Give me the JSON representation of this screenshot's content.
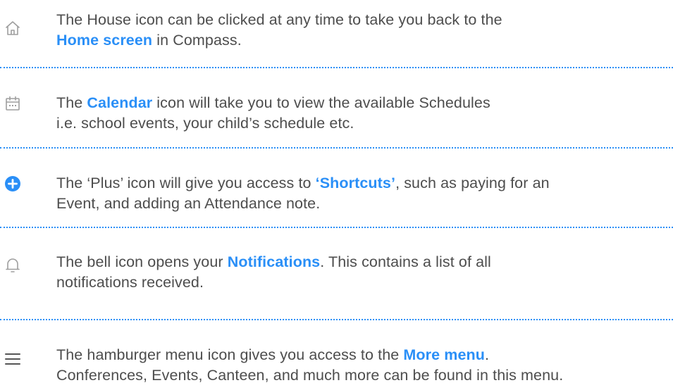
{
  "items": [
    {
      "icon": "house-icon",
      "line1": {
        "pre": "The House icon can be clicked at any time to take you back to the",
        "hl": "",
        "post": ""
      },
      "line2": {
        "pre": "",
        "hl": "Home screen",
        "post": " in Compass."
      }
    },
    {
      "icon": "calendar-icon",
      "line1": {
        "pre": "The ",
        "hl": "Calendar",
        "post": " icon will take you to view the available Schedules"
      },
      "line2": {
        "pre": "i.e. school events, your child’s schedule etc.",
        "hl": "",
        "post": ""
      }
    },
    {
      "icon": "plus-circle-icon",
      "line1": {
        "pre": "The ‘Plus’ icon will give you access to ",
        "hl": "‘Shortcuts’",
        "post": ", such as paying for an"
      },
      "line2": {
        "pre": "Event, and adding an Attendance note.",
        "hl": "",
        "post": ""
      }
    },
    {
      "icon": "bell-icon",
      "line1": {
        "pre": "The bell icon opens your ",
        "hl": "Notifications",
        "post": ". This contains a list of all"
      },
      "line2": {
        "pre": "notifications received.",
        "hl": "",
        "post": ""
      }
    },
    {
      "icon": "hamburger-menu-icon",
      "line1": {
        "pre": "The hamburger menu icon gives you access to the ",
        "hl": "More menu",
        "post": "."
      },
      "line2": {
        "pre": "Conferences, Events, Canteen, and much more can be found in this menu.",
        "hl": "",
        "post": ""
      }
    }
  ],
  "colors": {
    "accent": "#2a8ff7",
    "text": "#4d4d4d",
    "icon_grey": "#9e9e9e"
  }
}
